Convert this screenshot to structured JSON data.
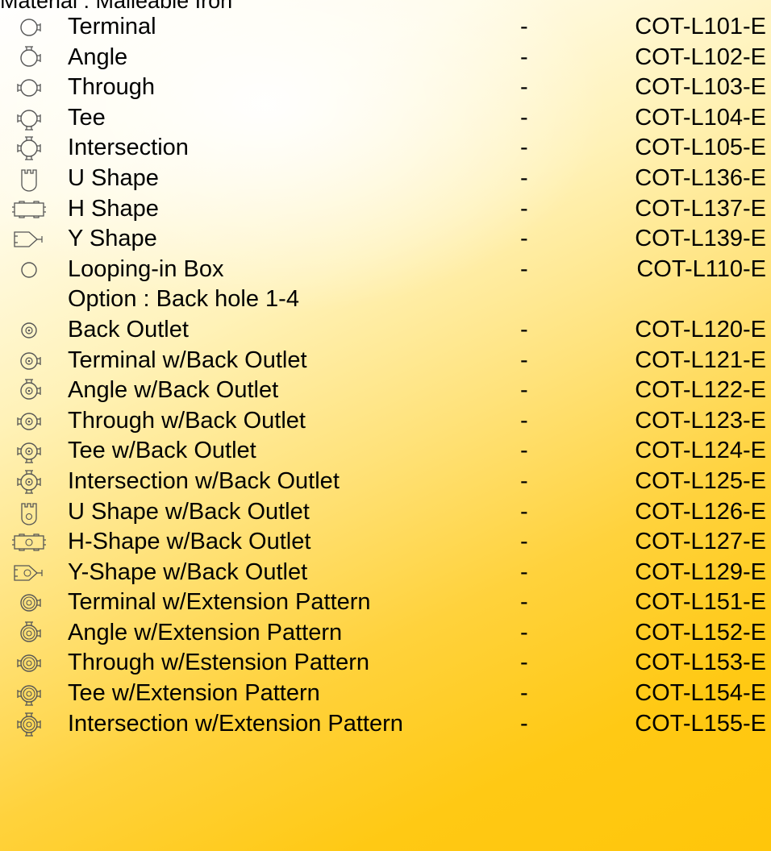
{
  "header": {
    "text": "Material : Malleable Iron"
  },
  "items": [
    {
      "name": "Terminal",
      "dash": "-",
      "code": "COT-L101-E",
      "icon": "terminal-box-icon"
    },
    {
      "name": "Angle",
      "dash": "-",
      "code": "COT-L102-E",
      "icon": "angle-box-icon"
    },
    {
      "name": "Through",
      "dash": "-",
      "code": "COT-L103-E",
      "icon": "through-box-icon"
    },
    {
      "name": "Tee",
      "dash": "-",
      "code": "COT-L104-E",
      "icon": "tee-box-icon"
    },
    {
      "name": "Intersection",
      "dash": "-",
      "code": "COT-L105-E",
      "icon": "intersection-box-icon"
    },
    {
      "name": "U Shape",
      "dash": "-",
      "code": "COT-L136-E",
      "icon": "u-shape-box-icon"
    },
    {
      "name": "H Shape",
      "dash": "-",
      "code": "COT-L137-E",
      "icon": "h-shape-box-icon"
    },
    {
      "name": "Y Shape",
      "dash": "-",
      "code": "COT-L139-E",
      "icon": "y-shape-box-icon"
    },
    {
      "name": "Looping-in Box",
      "dash": "-",
      "code": "COT-L110-E",
      "icon": "looping-in-box-icon"
    },
    {
      "name": "Option : Back hole 1-4",
      "dash": "",
      "code": "",
      "icon": ""
    },
    {
      "name": "Back Outlet",
      "dash": "-",
      "code": "COT-L120-E",
      "icon": "back-outlet-box-icon"
    },
    {
      "name": "Terminal w/Back Outlet",
      "dash": "-",
      "code": "COT-L121-E",
      "icon": "terminal-back-outlet-icon"
    },
    {
      "name": "Angle w/Back Outlet",
      "dash": "-",
      "code": "COT-L122-E",
      "icon": "angle-back-outlet-icon"
    },
    {
      "name": "Through w/Back Outlet",
      "dash": "-",
      "code": "COT-L123-E",
      "icon": "through-back-outlet-icon"
    },
    {
      "name": "Tee w/Back Outlet",
      "dash": "-",
      "code": "COT-L124-E",
      "icon": "tee-back-outlet-icon"
    },
    {
      "name": "Intersection w/Back Outlet",
      "dash": "-",
      "code": "COT-L125-E",
      "icon": "intersection-back-outlet-icon"
    },
    {
      "name": "U Shape w/Back Outlet",
      "dash": "-",
      "code": "COT-L126-E",
      "icon": "u-shape-back-outlet-icon"
    },
    {
      "name": "H-Shape w/Back Outlet",
      "dash": "-",
      "code": "COT-L127-E",
      "icon": "h-shape-back-outlet-icon"
    },
    {
      "name": "Y-Shape w/Back Outlet",
      "dash": "-",
      "code": "COT-L129-E",
      "icon": "y-shape-back-outlet-icon"
    },
    {
      "name": "Terminal w/Extension Pattern",
      "dash": "-",
      "code": "COT-L151-E",
      "icon": "terminal-extension-icon"
    },
    {
      "name": "Angle w/Extension Pattern",
      "dash": "-",
      "code": "COT-L152-E",
      "icon": "angle-extension-icon"
    },
    {
      "name": "Through w/Estension Pattern",
      "dash": "-",
      "code": "COT-L153-E",
      "icon": "through-extension-icon"
    },
    {
      "name": "Tee w/Extension Pattern",
      "dash": "-",
      "code": "COT-L154-E",
      "icon": "tee-extension-icon"
    },
    {
      "name": "Intersection w/Extension Pattern",
      "dash": "-",
      "code": "COT-L155-E",
      "icon": "intersection-extension-icon"
    }
  ]
}
